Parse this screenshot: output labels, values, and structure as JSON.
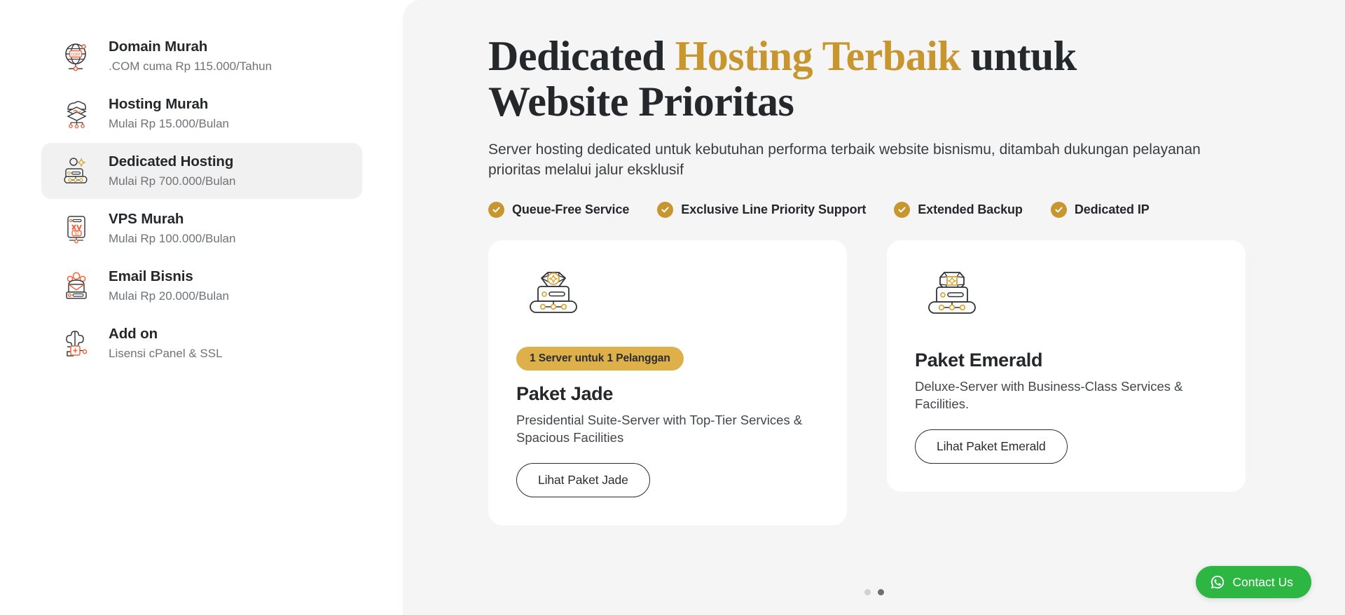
{
  "sidebar": {
    "items": [
      {
        "icon": "globe-com-icon",
        "title": "Domain Murah",
        "sub": ".COM cuma Rp 115.000/Tahun",
        "active": false
      },
      {
        "icon": "hosting-layers-icon",
        "title": "Hosting Murah",
        "sub": "Mulai Rp 15.000/Bulan",
        "active": false
      },
      {
        "icon": "dedicated-server-icon",
        "title": "Dedicated Hosting",
        "sub": "Mulai Rp 700.000/Bulan",
        "active": true
      },
      {
        "icon": "vps-id-icon",
        "title": "VPS Murah",
        "sub": "Mulai Rp 100.000/Bulan",
        "active": false
      },
      {
        "icon": "email-people-icon",
        "title": "Email Bisnis",
        "sub": "Mulai Rp 20.000/Bulan",
        "active": false
      },
      {
        "icon": "puzzle-plus-icon",
        "title": "Add on",
        "sub": "Lisensi cPanel & SSL",
        "active": false
      }
    ]
  },
  "hero": {
    "heading_part1": "Dedicated ",
    "heading_highlight": "Hosting Terbaik",
    "heading_part2": " untuk Website Prioritas",
    "subtitle": "Server hosting dedicated untuk kebutuhan performa terbaik website bisnismu, ditambah dukungan pelayanan prioritas melalui jalur eksklusif",
    "features": [
      "Queue-Free Service",
      "Exclusive Line Priority Support",
      "Extended Backup",
      "Dedicated IP"
    ]
  },
  "cards": [
    {
      "icon": "jade-server-icon",
      "badge": "1 Server untuk 1 Pelanggan",
      "title": "Paket Jade",
      "desc": "Presidential Suite-Server with Top-Tier Services & Spacious Facilities",
      "button": "Lihat Paket Jade"
    },
    {
      "icon": "emerald-server-icon",
      "badge": "",
      "title": "Paket Emerald",
      "desc": "Deluxe-Server with Business-Class Services & Facilities.",
      "button": "Lihat Paket Emerald"
    }
  ],
  "carousel": {
    "dots": 2,
    "active_index": 1
  },
  "contact": {
    "label": "Contact Us",
    "icon": "whatsapp-icon"
  },
  "colors": {
    "gold": "#c8962e",
    "badge_gold": "#ddb049",
    "orange_accent": "#f4633a",
    "whatsapp_green": "#2db742",
    "main_bg": "#f5f5f5",
    "active_item_bg": "#f1f1f1"
  }
}
